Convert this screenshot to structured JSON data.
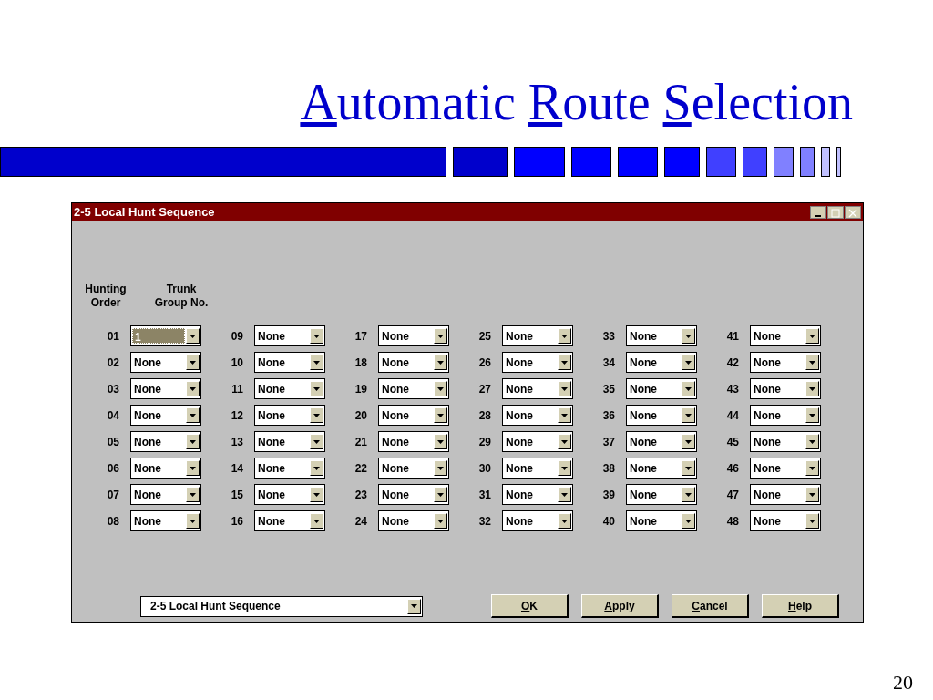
{
  "slide": {
    "title_words": [
      "Automatic",
      "Route",
      "Selection"
    ],
    "page_number": "20"
  },
  "window": {
    "title": "2-5 Local Hunt Sequence"
  },
  "headers": {
    "hunting_order": "Hunting Order",
    "trunk_group": "Trunk Group No."
  },
  "columns": [
    [
      {
        "order": "01",
        "value": "1",
        "focused": true
      },
      {
        "order": "02",
        "value": "None",
        "focused": false
      },
      {
        "order": "03",
        "value": "None",
        "focused": false
      },
      {
        "order": "04",
        "value": "None",
        "focused": false
      },
      {
        "order": "05",
        "value": "None",
        "focused": false
      },
      {
        "order": "06",
        "value": "None",
        "focused": false
      },
      {
        "order": "07",
        "value": "None",
        "focused": false
      },
      {
        "order": "08",
        "value": "None",
        "focused": false
      }
    ],
    [
      {
        "order": "09",
        "value": "None",
        "focused": false
      },
      {
        "order": "10",
        "value": "None",
        "focused": false
      },
      {
        "order": "11",
        "value": "None",
        "focused": false
      },
      {
        "order": "12",
        "value": "None",
        "focused": false
      },
      {
        "order": "13",
        "value": "None",
        "focused": false
      },
      {
        "order": "14",
        "value": "None",
        "focused": false
      },
      {
        "order": "15",
        "value": "None",
        "focused": false
      },
      {
        "order": "16",
        "value": "None",
        "focused": false
      }
    ],
    [
      {
        "order": "17",
        "value": "None",
        "focused": false
      },
      {
        "order": "18",
        "value": "None",
        "focused": false
      },
      {
        "order": "19",
        "value": "None",
        "focused": false
      },
      {
        "order": "20",
        "value": "None",
        "focused": false
      },
      {
        "order": "21",
        "value": "None",
        "focused": false
      },
      {
        "order": "22",
        "value": "None",
        "focused": false
      },
      {
        "order": "23",
        "value": "None",
        "focused": false
      },
      {
        "order": "24",
        "value": "None",
        "focused": false
      }
    ],
    [
      {
        "order": "25",
        "value": "None",
        "focused": false
      },
      {
        "order": "26",
        "value": "None",
        "focused": false
      },
      {
        "order": "27",
        "value": "None",
        "focused": false
      },
      {
        "order": "28",
        "value": "None",
        "focused": false
      },
      {
        "order": "29",
        "value": "None",
        "focused": false
      },
      {
        "order": "30",
        "value": "None",
        "focused": false
      },
      {
        "order": "31",
        "value": "None",
        "focused": false
      },
      {
        "order": "32",
        "value": "None",
        "focused": false
      }
    ],
    [
      {
        "order": "33",
        "value": "None",
        "focused": false
      },
      {
        "order": "34",
        "value": "None",
        "focused": false
      },
      {
        "order": "35",
        "value": "None",
        "focused": false
      },
      {
        "order": "36",
        "value": "None",
        "focused": false
      },
      {
        "order": "37",
        "value": "None",
        "focused": false
      },
      {
        "order": "38",
        "value": "None",
        "focused": false
      },
      {
        "order": "39",
        "value": "None",
        "focused": false
      },
      {
        "order": "40",
        "value": "None",
        "focused": false
      }
    ],
    [
      {
        "order": "41",
        "value": "None",
        "focused": false
      },
      {
        "order": "42",
        "value": "None",
        "focused": false
      },
      {
        "order": "43",
        "value": "None",
        "focused": false
      },
      {
        "order": "44",
        "value": "None",
        "focused": false
      },
      {
        "order": "45",
        "value": "None",
        "focused": false
      },
      {
        "order": "46",
        "value": "None",
        "focused": false
      },
      {
        "order": "47",
        "value": "None",
        "focused": false
      },
      {
        "order": "48",
        "value": "None",
        "focused": false
      }
    ]
  ],
  "screen_select": {
    "value": "2-5 Local Hunt Sequence"
  },
  "buttons": [
    "OK",
    "Apply",
    "Cancel",
    "Help"
  ]
}
